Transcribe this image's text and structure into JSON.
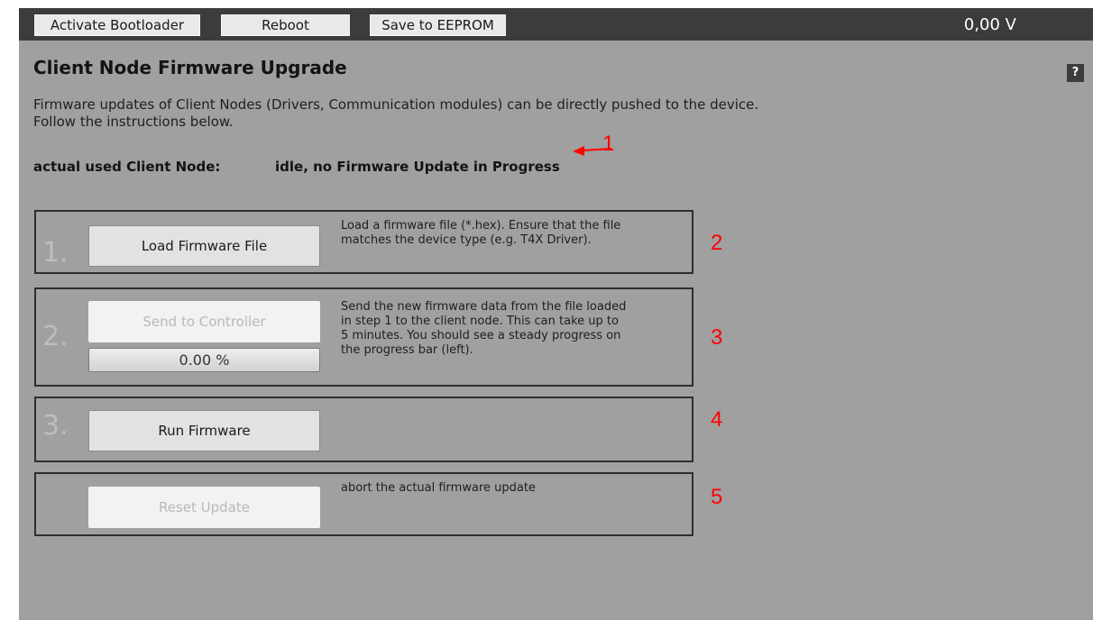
{
  "toolbar": {
    "activate_bootloader": "Activate Bootloader",
    "reboot": "Reboot",
    "save_eeprom": "Save to EEPROM",
    "voltage": "0,00 V"
  },
  "help": {
    "label": "?"
  },
  "page": {
    "title": "Client Node Firmware Upgrade",
    "description_line1": "Firmware updates of Client Nodes (Drivers, Communication modules) can be directly pushed to the device.",
    "description_line2": "Follow the instructions below.",
    "status_label": "actual used Client Node:",
    "status_value": "idle, no Firmware Update in Progress"
  },
  "steps": [
    {
      "number": "1.",
      "button": "Load Firmware File",
      "button_enabled": true,
      "text": [
        "Load a firmware file (*.hex). Ensure that the file",
        "matches the device type (e.g. T4X Driver)."
      ]
    },
    {
      "number": "2.",
      "button": "Send to Controller",
      "button_enabled": false,
      "text": [
        "Send the new firmware data from the file loaded",
        "in step 1 to the client node. This can take up to",
        "5 minutes. You should see a steady progress on",
        "the progress bar (left)."
      ],
      "progress": {
        "label": "0.00 %",
        "fraction": 0.0
      }
    },
    {
      "number": "3.",
      "button": "Run Firmware",
      "button_enabled": true,
      "text": []
    },
    {
      "number": "",
      "button": "Reset Update",
      "button_enabled": false,
      "text": [
        "abort the actual firmware update"
      ]
    }
  ],
  "annotations": [
    "1",
    "2",
    "3",
    "4",
    "5"
  ],
  "colors": {
    "background": "#a0a0a0",
    "toolbar": "#3c3c3c",
    "annotation": "#ff0000",
    "box_border": "#2e2e2e",
    "step_number": "#bdbdbd"
  },
  "icons": {
    "annotation_pointer": "arrow-left-icon"
  }
}
